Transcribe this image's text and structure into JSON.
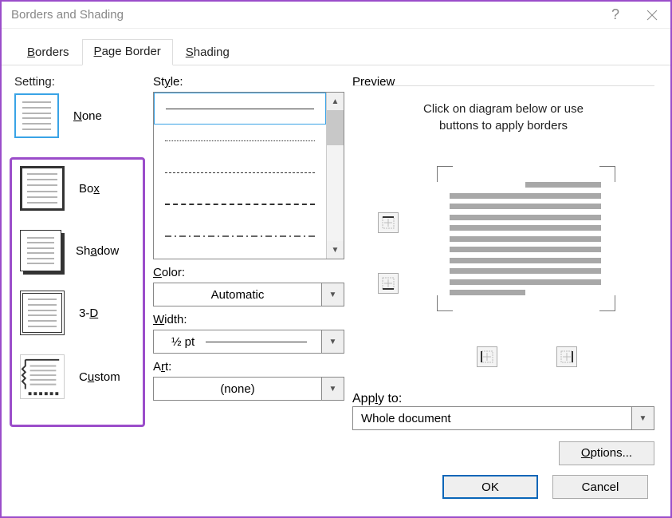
{
  "title": "Borders and Shading",
  "tabs": {
    "borders": "Borders",
    "page_border": "Page Border",
    "shading": "Shading"
  },
  "setting": {
    "label": "Setting:",
    "none": "None",
    "box": "Box",
    "shadow": "Shadow",
    "threed": "3-D",
    "custom": "Custom"
  },
  "style": {
    "label": "Style:",
    "color_label": "Color:",
    "color_value": "Automatic",
    "width_label": "Width:",
    "width_value": "½ pt",
    "art_label": "Art:",
    "art_value": "(none)"
  },
  "preview": {
    "label": "Preview",
    "hint1": "Click on diagram below or use",
    "hint2": "buttons to apply borders",
    "apply_label": "Apply to:",
    "apply_value": "Whole document",
    "options": "Options..."
  },
  "footer": {
    "ok": "OK",
    "cancel": "Cancel"
  }
}
